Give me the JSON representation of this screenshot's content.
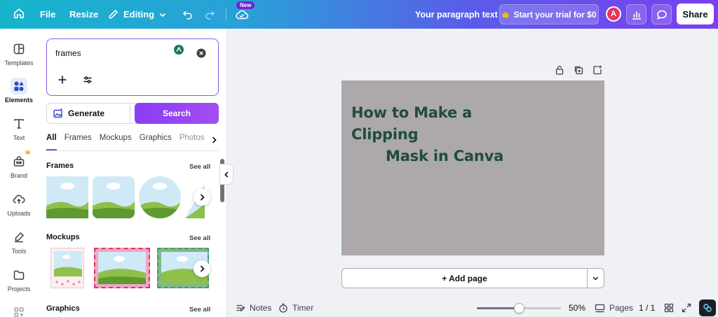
{
  "topbar": {
    "file_label": "File",
    "resize_label": "Resize",
    "editing_label": "Editing",
    "new_badge": "New",
    "doc_title": "Your paragraph text",
    "trial_label": "Start your trial for $0",
    "avatar_initial": "A",
    "share_label": "Share"
  },
  "rail": {
    "items": [
      {
        "label": "Templates"
      },
      {
        "label": "Elements"
      },
      {
        "label": "Text"
      },
      {
        "label": "Brand"
      },
      {
        "label": "Uploads"
      },
      {
        "label": "Tools"
      },
      {
        "label": "Projects"
      }
    ]
  },
  "panel": {
    "search_value": "frames",
    "generate_label": "Generate",
    "search_button": "Search",
    "tabs": [
      "All",
      "Frames",
      "Mockups",
      "Graphics",
      "Photos"
    ],
    "sections": [
      {
        "title": "Frames",
        "see_all": "See all"
      },
      {
        "title": "Mockups",
        "see_all": "See all"
      },
      {
        "title": "Graphics",
        "see_all": "See all"
      }
    ]
  },
  "canvas": {
    "title_line1": "How to Make a Clipping",
    "title_line2": "Mask in Canva",
    "page_bg": "#ada8ab",
    "title_color": "#1e4d40",
    "add_page_label": "+ Add page"
  },
  "bottom": {
    "notes_label": "Notes",
    "timer_label": "Timer",
    "zoom_value": 0.5,
    "zoom_label": "50%",
    "pages_label": "Pages",
    "page_count": "1 / 1"
  }
}
